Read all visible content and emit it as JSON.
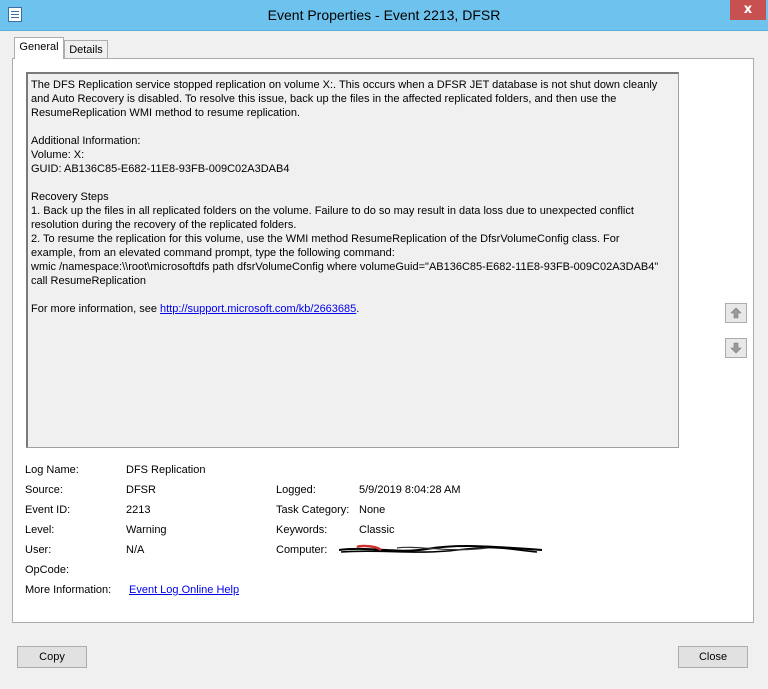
{
  "window": {
    "title": "Event Properties - Event 2213, DFSR",
    "close_glyph": "x"
  },
  "tabs": [
    {
      "label": "General",
      "active": true
    },
    {
      "label": "Details",
      "active": false
    }
  ],
  "description": {
    "lines": [
      "The DFS Replication service stopped replication on volume X:. This occurs when a DFSR JET database is not shut down cleanly",
      "and Auto Recovery is disabled. To resolve this issue, back up the files in the affected replicated folders, and then use the",
      "ResumeReplication WMI method to resume replication.",
      "",
      "Additional Information:",
      "Volume: X:",
      "GUID: AB136C85-E682-11E8-93FB-009C02A3DAB4",
      "",
      "Recovery Steps",
      "1. Back up the files in all replicated folders on the volume. Failure to do so may result in data loss due to unexpected conflict",
      "resolution during the recovery of the replicated folders.",
      "2. To resume the replication for this volume, use the WMI method ResumeReplication of the DfsrVolumeConfig class. For",
      "example, from an elevated command prompt, type the following command:",
      "wmic /namespace:\\\\root\\microsoftdfs path dfsrVolumeConfig where volumeGuid=\"AB136C85-E682-11E8-93FB-009C02A3DAB4\"",
      "call ResumeReplication",
      ""
    ],
    "more_info_prefix": "For more information, see ",
    "more_info_link": "http://support.microsoft.com/kb/2663685",
    "more_info_suffix": "."
  },
  "fields": {
    "log_name": {
      "label": "Log Name:",
      "value": "DFS Replication"
    },
    "source": {
      "label": "Source:",
      "value": "DFSR"
    },
    "event_id": {
      "label": "Event ID:",
      "value": "2213"
    },
    "level": {
      "label": "Level:",
      "value": "Warning"
    },
    "user": {
      "label": "User:",
      "value": "N/A"
    },
    "opcode": {
      "label": "OpCode:",
      "value": ""
    },
    "more_information": {
      "label": "More Information:",
      "value": "Event Log Online Help"
    },
    "logged": {
      "label": "Logged:",
      "value": "5/9/2019 8:04:28 AM"
    },
    "task_category": {
      "label": "Task Category:",
      "value": "None"
    },
    "keywords": {
      "label": "Keywords:",
      "value": "Classic"
    },
    "computer": {
      "label": "Computer:",
      "value": ""
    }
  },
  "buttons": {
    "copy": "Copy",
    "close": "Close"
  },
  "icons": {
    "app": "event-properties-icon",
    "up": "arrow-up-icon",
    "down": "arrow-down-icon"
  },
  "colors": {
    "titlebar": "#6ec3ee",
    "close": "#c75050",
    "link": "#0000ee"
  }
}
